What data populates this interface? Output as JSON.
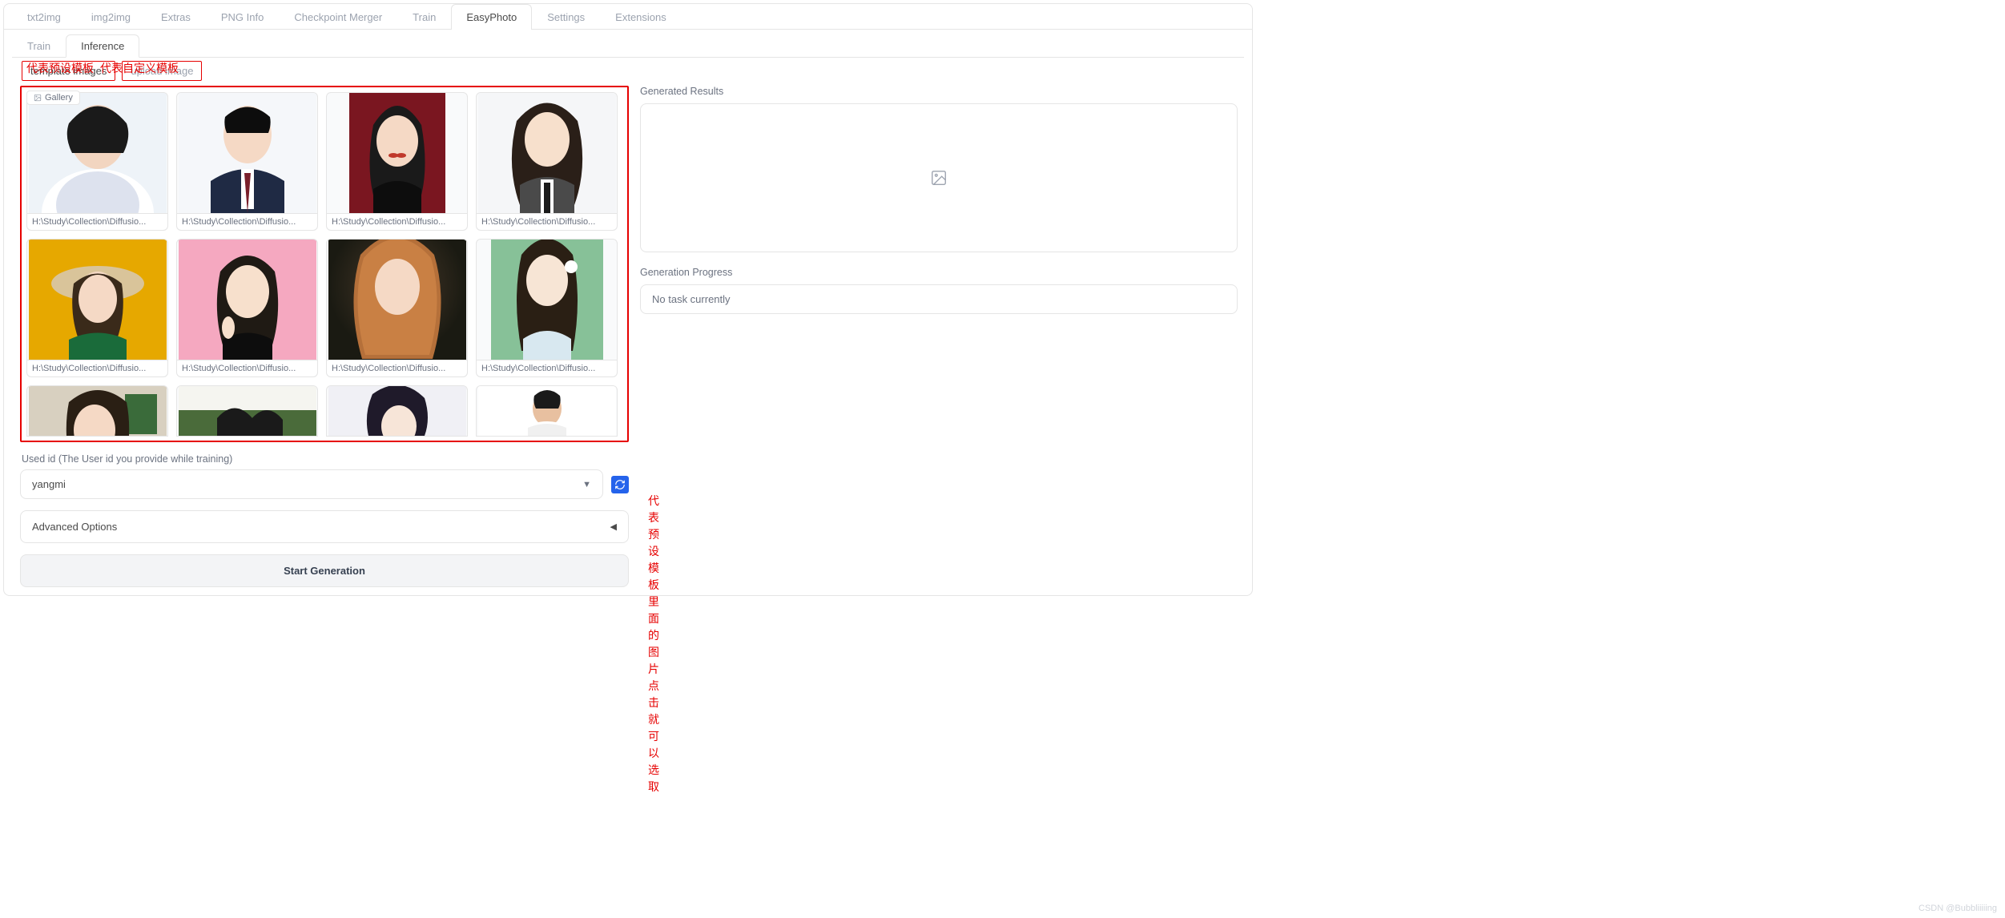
{
  "main_tabs": {
    "items": [
      "txt2img",
      "img2img",
      "Extras",
      "PNG Info",
      "Checkpoint Merger",
      "Train",
      "EasyPhoto",
      "Settings",
      "Extensions"
    ],
    "active_index": 6
  },
  "sub_tabs": {
    "items": [
      "Train",
      "Inference"
    ],
    "active_index": 1
  },
  "template_tabs": {
    "active": "template images",
    "inactive": "upload image"
  },
  "annotations": {
    "preset_label": "代表预设模板",
    "custom_label": "代表自定义模板",
    "gallery_note_line1": "代表预设模板里面的图片",
    "gallery_note_line2": "点击就可以选取"
  },
  "gallery": {
    "badge": "Gallery",
    "caption": "H:\\Study\\Collection\\Diffusio..."
  },
  "used_id": {
    "label": "Used id (The User id you provide while training)",
    "value": "yangmi"
  },
  "advanced": {
    "label": "Advanced Options"
  },
  "generate_btn": "Start Generation",
  "results": {
    "label": "Generated Results",
    "progress_label": "Generation Progress",
    "progress_text": "No task currently"
  },
  "watermark": "CSDN @Bubbliiiiing"
}
